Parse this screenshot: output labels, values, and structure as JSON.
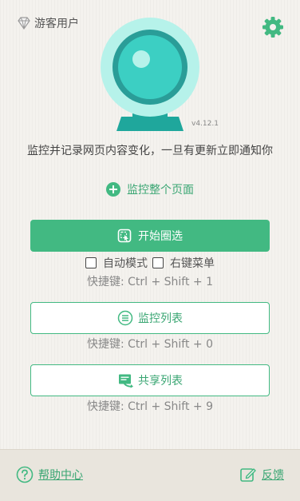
{
  "header": {
    "user_label": "游客用户"
  },
  "logo": {
    "version": "v4.12.1"
  },
  "description": "监控并记录网页内容变化，一旦有更新立即通知你",
  "monitor_whole_page": "监控整个页面",
  "start_select": {
    "label": "开始圈选",
    "option_auto": "自动模式",
    "option_context": "右键菜单",
    "hotkey": "快捷键: Ctrl + Shift + 1"
  },
  "monitor_list": {
    "label": "监控列表",
    "hotkey": "快捷键: Ctrl + Shift + 0"
  },
  "shared_list": {
    "label": "共享列表",
    "hotkey": "快捷键: Ctrl + Shift + 9"
  },
  "footer": {
    "help": "帮助中心",
    "feedback": "反馈"
  },
  "colors": {
    "accent": "#42b982",
    "accent_text": "#3aa673",
    "logo_teal": "#3ccfc3",
    "logo_light": "#b6f2ea"
  },
  "icons": [
    "diamond-icon",
    "gear-icon",
    "plus-circle-icon",
    "select-icon",
    "list-icon",
    "share-icon",
    "help-icon",
    "edit-icon"
  ]
}
